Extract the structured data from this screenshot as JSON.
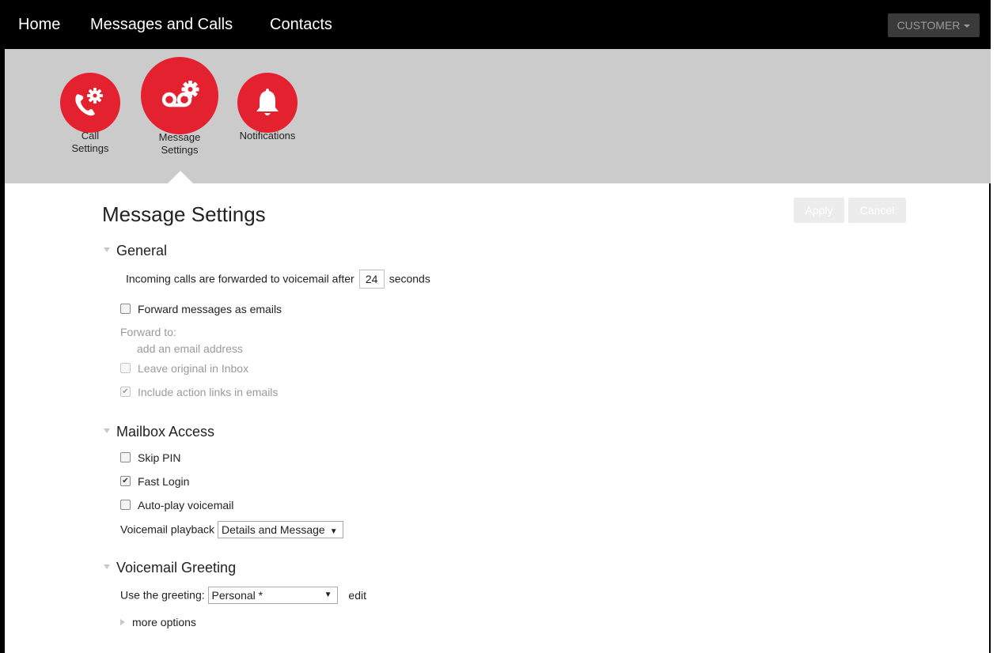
{
  "nav": {
    "items": [
      "Home",
      "Messages and Calls",
      "Contacts"
    ],
    "account_label": "CUSTOMER"
  },
  "settings_nav": {
    "call": {
      "line1": "Call",
      "line2": "Settings"
    },
    "message": {
      "line1": "Message",
      "line2": "Settings"
    },
    "notifications": {
      "label": "Notifications"
    }
  },
  "page": {
    "title": "Message Settings",
    "apply_label": "Apply",
    "cancel_label": "Cancel"
  },
  "general": {
    "heading": "General",
    "forward_prefix": "Incoming calls are forwarded to voicemail after",
    "forward_seconds": "24",
    "forward_suffix": "seconds",
    "forward_emails_label": "Forward messages as emails",
    "forward_emails_checked": false,
    "forward_to_label": "Forward to:",
    "add_email_label": "add an email address",
    "leave_original_label": "Leave original in Inbox",
    "leave_original_checked": false,
    "include_links_label": "Include action links in emails",
    "include_links_checked": true
  },
  "mailbox": {
    "heading": "Mailbox Access",
    "skip_pin_label": "Skip PIN",
    "skip_pin_checked": false,
    "fast_login_label": "Fast Login",
    "fast_login_checked": true,
    "autoplay_label": "Auto-play voicemail",
    "autoplay_checked": false,
    "playback_label": "Voicemail playback",
    "playback_value": "Details and Message"
  },
  "greeting": {
    "heading": "Voicemail Greeting",
    "use_label": "Use the greeting:",
    "greeting_value": "Personal *",
    "edit_label": "edit",
    "more_options_label": "more options"
  },
  "colors": {
    "accent": "#e3212f",
    "band": "#cbcbcb",
    "nav_bg": "#000000"
  },
  "icons": [
    "phone-gear-icon",
    "voicemail-gear-icon",
    "bell-icon"
  ]
}
